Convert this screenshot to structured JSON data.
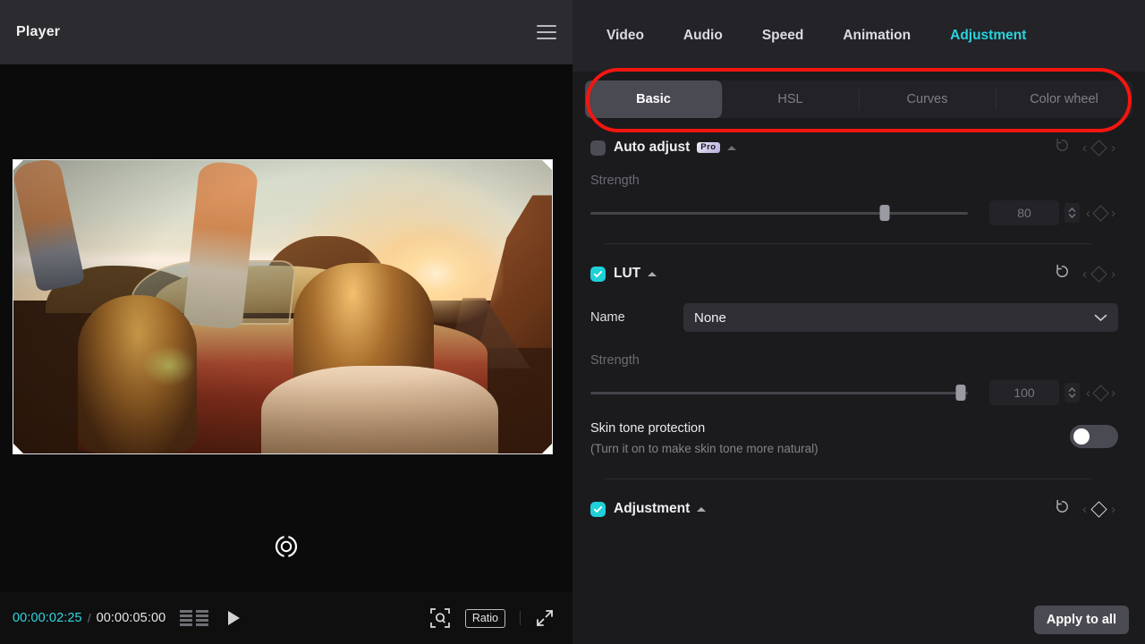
{
  "player": {
    "title": "Player",
    "menu_icon": "hamburger-icon",
    "current_time": "00:00:02:25",
    "time_separator": "/",
    "total_time": "00:00:05:00",
    "frames_icon": "filmstrip-icon",
    "play_icon": "play-icon",
    "zoom_icon": "zoom-fit-icon",
    "ratio_label": "Ratio",
    "fullscreen_icon": "fullscreen-icon",
    "reset_transform_icon": "reset-rotation-icon"
  },
  "inspector": {
    "tabs": [
      {
        "label": "Video",
        "active": false
      },
      {
        "label": "Audio",
        "active": false
      },
      {
        "label": "Speed",
        "active": false
      },
      {
        "label": "Animation",
        "active": false
      },
      {
        "label": "Adjustment",
        "active": true
      }
    ],
    "segments": [
      {
        "label": "Basic",
        "active": true
      },
      {
        "label": "HSL",
        "active": false
      },
      {
        "label": "Curves",
        "active": false
      },
      {
        "label": "Color wheel",
        "active": false
      }
    ],
    "auto_adjust": {
      "label": "Auto adjust",
      "badge": "Pro",
      "checked": false,
      "strength_label": "Strength",
      "strength_value": "80",
      "strength_percent": 78
    },
    "lut": {
      "label": "LUT",
      "checked": true,
      "name_label": "Name",
      "name_value": "None",
      "strength_label": "Strength",
      "strength_value": "100",
      "strength_percent": 98
    },
    "skin_tone": {
      "title": "Skin tone protection",
      "hint": "(Turn it on to make skin tone more natural)",
      "enabled": false
    },
    "adjustment": {
      "label": "Adjustment",
      "checked": true
    },
    "apply_button": "Apply to all"
  },
  "colors": {
    "accent_cyan": "#28d3dd",
    "highlight_ring": "#f5150f",
    "panel_bg": "#1b1b1e",
    "tabbar_bg": "#232328",
    "active_segment": "#4a4a52"
  }
}
